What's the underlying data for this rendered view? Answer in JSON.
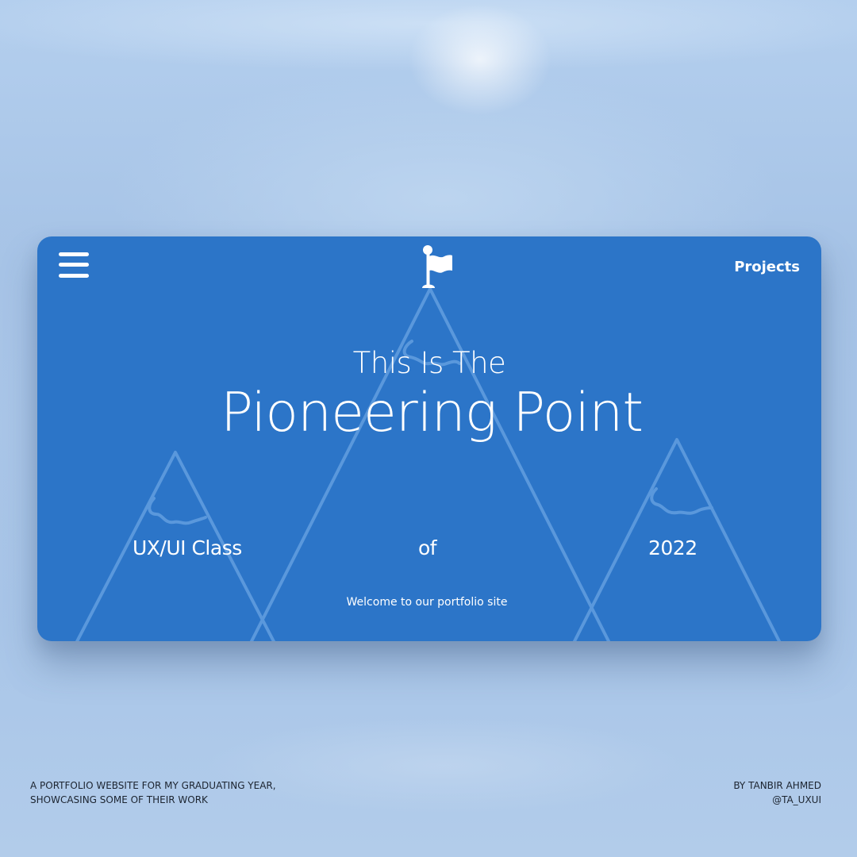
{
  "nav": {
    "menu_icon": "hamburger-menu-icon",
    "logo_icon": "flag-icon",
    "projects_label": "Projects"
  },
  "hero": {
    "pre_title": "This Is The",
    "title": "Pioneering Point",
    "class_label": "UX/UI Class",
    "of_label": "of",
    "year": "2022",
    "welcome": "Welcome to our portfolio site"
  },
  "footer": {
    "left_line1": "A PORTFOLIO WEBSITE FOR MY GRADUATING YEAR,",
    "left_line2": "SHOWCASING SOME OF THEIR WORK",
    "right_line1": "BY TANBIR AHMED",
    "right_line2": "@TA_UXUI"
  },
  "colors": {
    "background": "#a9c6e8",
    "card": "#2c75c8",
    "mountain_lines": "#5a98dc",
    "text_light": "#ffffff",
    "text_dark": "#1c2430"
  }
}
